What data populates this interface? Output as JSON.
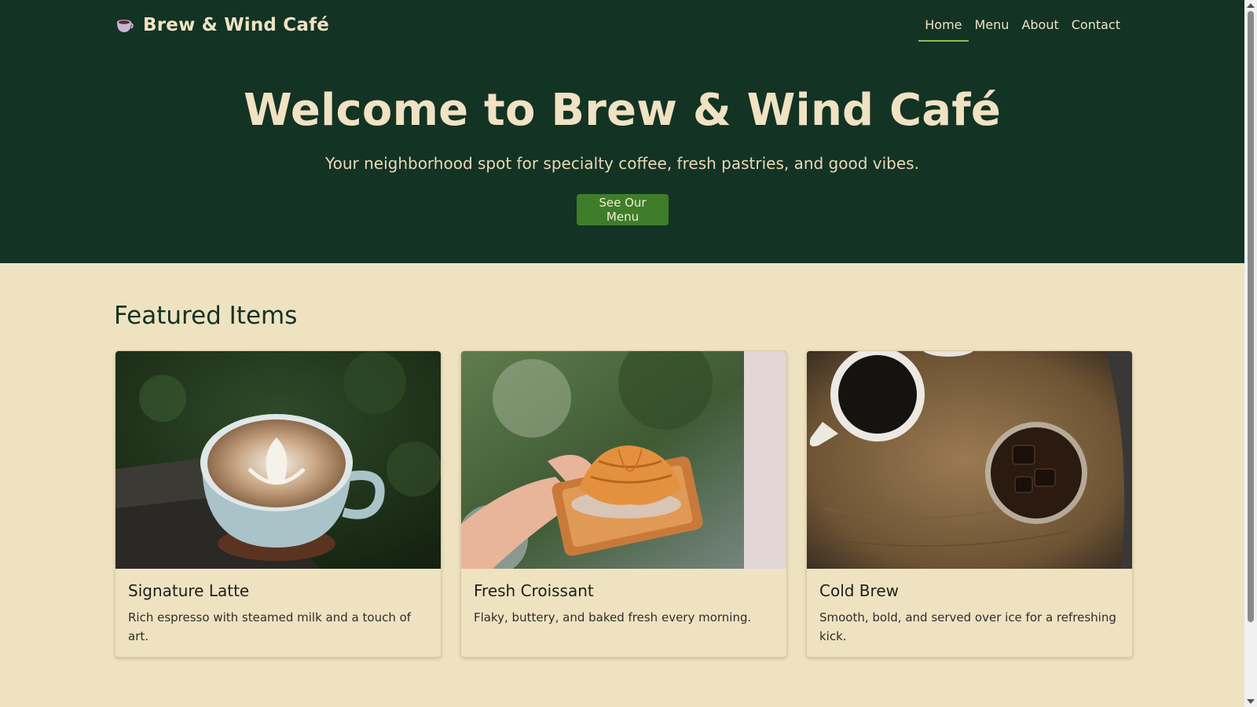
{
  "header": {
    "brand_title": "Brew & Wind Café",
    "nav": [
      {
        "label": "Home",
        "active": true
      },
      {
        "label": "Menu",
        "active": false
      },
      {
        "label": "About",
        "active": false
      },
      {
        "label": "Contact",
        "active": false
      }
    ]
  },
  "hero": {
    "title": "Welcome to Brew & Wind Café",
    "subtitle": "Your neighborhood spot for specialty coffee, fresh pastries, and good vibes.",
    "cta_label": "See Our Menu"
  },
  "featured": {
    "heading": "Featured Items",
    "items": [
      {
        "title": "Signature Latte",
        "description": "Rich espresso with steamed milk and a touch of art.",
        "image": "latte-art-photo"
      },
      {
        "title": "Fresh Croissant",
        "description": "Flaky, buttery, and baked fresh every morning.",
        "image": "croissant-photo"
      },
      {
        "title": "Cold Brew",
        "description": "Smooth, bold, and served over ice for a refreshing kick.",
        "image": "cold-brew-photo"
      }
    ]
  },
  "colors": {
    "header_bg": "#133324",
    "page_bg": "#efe2c0",
    "accent_green": "#3e7d2a",
    "text_cream": "#f0e2c3"
  },
  "icons": {
    "brand": "coffee-cup-icon"
  }
}
